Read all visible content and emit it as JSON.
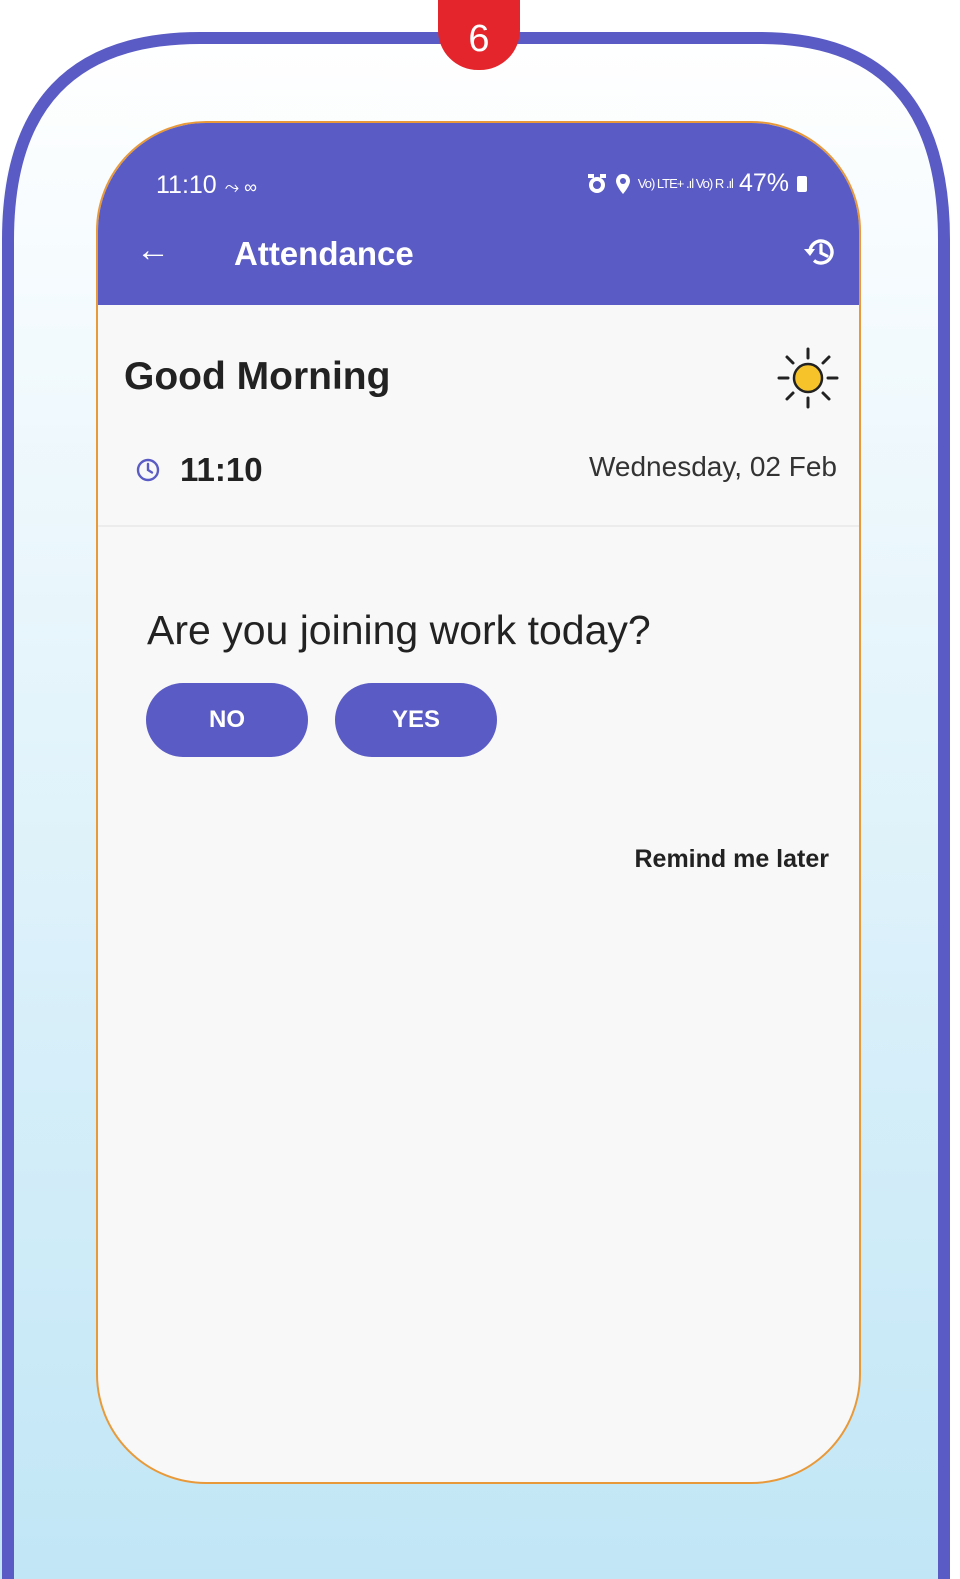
{
  "step_badge": "6",
  "status_bar": {
    "time": "11:10",
    "extra_icons": "⤳ ∞",
    "signal_text": "Vo) LTE+ .ıl Vo) R .ıl",
    "battery": "47%"
  },
  "appbar": {
    "title": "Attendance"
  },
  "greeting_card": {
    "greeting": "Good Morning",
    "time": "11:10",
    "date": "Wednesday, 02 Feb"
  },
  "prompt": {
    "question": "Are you joining work today?",
    "no_label": "NO",
    "yes_label": "YES",
    "remind_label": "Remind me later"
  },
  "colors": {
    "primary": "#5a5bc4",
    "badge": "#e4262c",
    "phone_border": "#e89a3a",
    "sun": "#f6c32a"
  }
}
